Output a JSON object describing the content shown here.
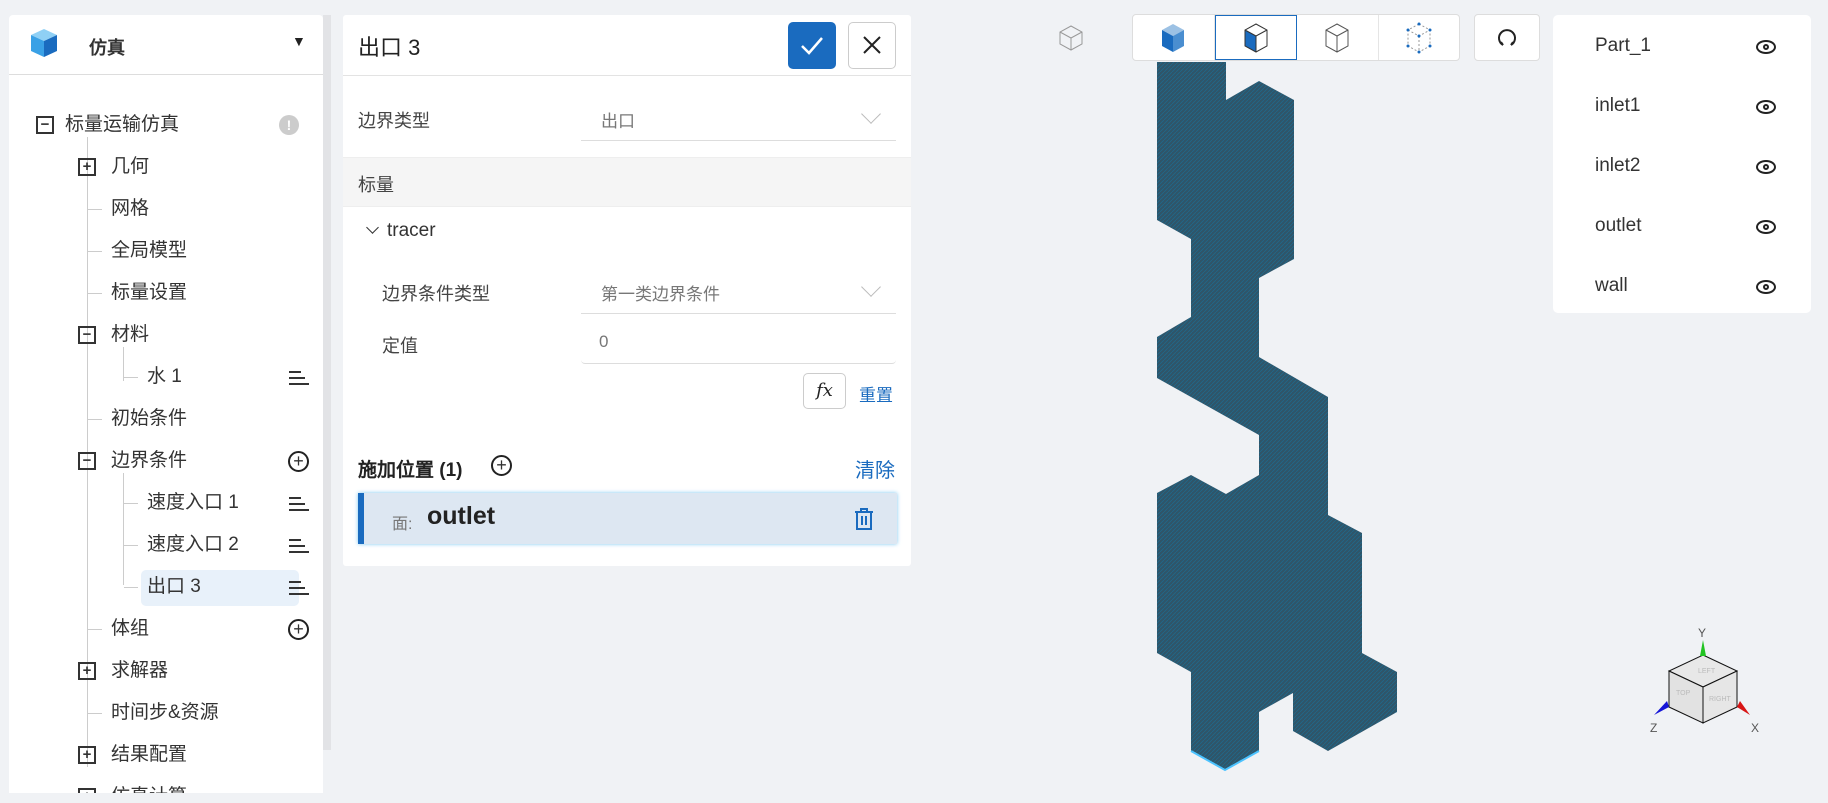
{
  "sidebar": {
    "title": "仿真",
    "tree": [
      {
        "label": "标量运输仿真",
        "level": 0,
        "toggle": "minus",
        "action": "warning"
      },
      {
        "label": "几何",
        "level": 1,
        "toggle": "plus"
      },
      {
        "label": "网格",
        "level": 1
      },
      {
        "label": "全局模型",
        "level": 1
      },
      {
        "label": "标量设置",
        "level": 1
      },
      {
        "label": "材料",
        "level": 1,
        "toggle": "minus"
      },
      {
        "label": "水 1",
        "level": 2,
        "action": "menu"
      },
      {
        "label": "初始条件",
        "level": 1
      },
      {
        "label": "边界条件",
        "level": 1,
        "toggle": "minus",
        "action": "add"
      },
      {
        "label": "速度入口 1",
        "level": 2,
        "action": "menu"
      },
      {
        "label": "速度入口 2",
        "level": 2,
        "action": "menu"
      },
      {
        "label": "出口 3",
        "level": 2,
        "action": "menu",
        "selected": true
      },
      {
        "label": "体组",
        "level": 1,
        "action": "add"
      },
      {
        "label": "求解器",
        "level": 1,
        "toggle": "plus"
      },
      {
        "label": "时间步&资源",
        "level": 1
      },
      {
        "label": "结果配置",
        "level": 1,
        "toggle": "plus"
      },
      {
        "label": "仿真计算",
        "level": 1,
        "toggle": "plus"
      }
    ]
  },
  "form": {
    "title": "出口 3",
    "boundary_type_label": "边界类型",
    "boundary_type_value": "出口",
    "section_scalar": "标量",
    "tracer_label": "tracer",
    "bc_type_label": "边界条件类型",
    "bc_type_value": "第一类边界条件",
    "fixed_value_label": "定值",
    "fixed_value": "0",
    "fx_label": "fx",
    "reset_label": "重置",
    "apply_label": "施加位置 (1)",
    "clear_label": "清除",
    "location_prefix": "面:",
    "location_value": "outlet"
  },
  "parts": [
    "Part_1",
    "inlet1",
    "inlet2",
    "outlet",
    "wall"
  ],
  "axes": {
    "x": "X",
    "y": "Y",
    "z": "Z",
    "cube_faces": [
      "LEFT",
      "TOP",
      "RIGHT"
    ]
  },
  "colors": {
    "accent": "#1a6bbf",
    "mesh": "#2f5569",
    "selected_row": "#e8f1fa"
  }
}
